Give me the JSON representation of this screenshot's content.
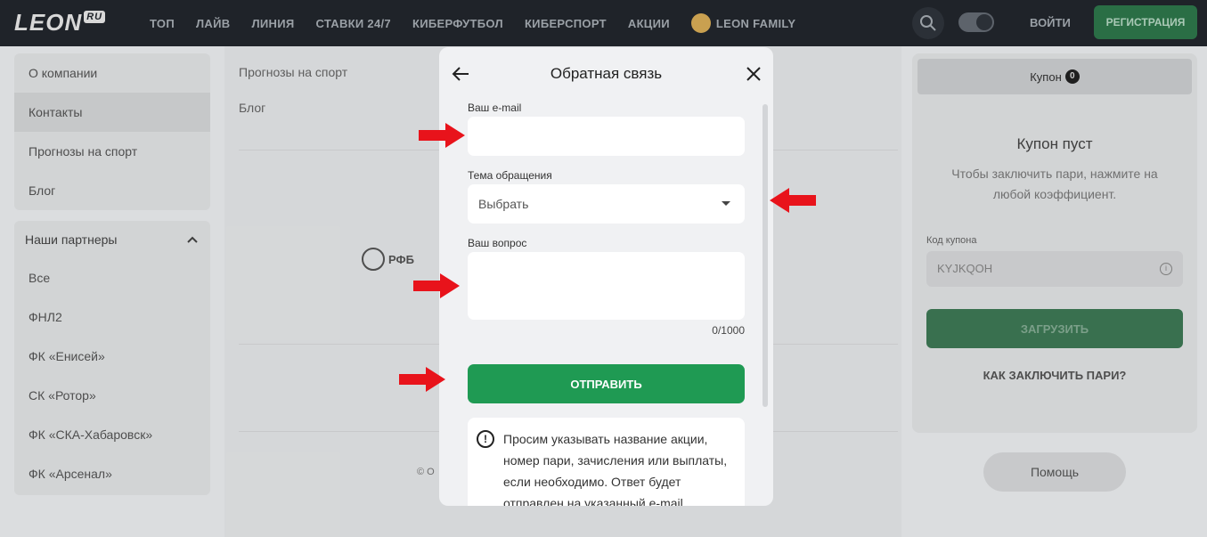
{
  "header": {
    "logo_text": "LEON",
    "logo_suffix": "RU",
    "nav": [
      "ТОП",
      "ЛАЙВ",
      "ЛИНИЯ",
      "СТАВКИ 24/7",
      "КИБЕРФУТБОЛ",
      "КИБЕРСПОРТ",
      "АКЦИИ"
    ],
    "family_label": "LEON FAMILY",
    "login_label": "ВОЙТИ",
    "register_label": "РЕГИСТРАЦИЯ"
  },
  "sidebar": {
    "info_items": [
      "О компании",
      "Контакты",
      "Прогнозы на спорт",
      "Блог"
    ],
    "partners_title": "Наши партнеры",
    "partner_items": [
      "Все",
      "ФНЛ2",
      "ФК «Енисей»",
      "СК «Ротор»",
      "ФК «СКА-Хабаровск»",
      "ФК «Арсенал»"
    ]
  },
  "center": {
    "link1": "Прогнозы на спорт",
    "link2": "Блог",
    "partner_logo": "РФБ",
    "copyright": "© О"
  },
  "coupon": {
    "tab_label": "Купон",
    "tab_count": "0",
    "empty_title": "Купон пуст",
    "empty_hint": "Чтобы заключить пари, нажмите на любой коэффициент.",
    "code_label": "Код купона",
    "code_value": "KYJKQOH",
    "load_label": "ЗАГРУЗИТЬ",
    "how_label": "КАК ЗАКЛЮЧИТЬ ПАРИ?",
    "help_label": "Помощь"
  },
  "modal": {
    "title": "Обратная связь",
    "email_label": "Ваш e-mail",
    "email_value": "",
    "topic_label": "Тема обращения",
    "topic_value": "Выбрать",
    "question_label": "Ваш вопрос",
    "question_value": "",
    "counter": "0/1000",
    "submit_label": "ОТПРАВИТЬ",
    "notice_text": "Просим указывать название акции, номер пари, зачисления или выплаты, если необходимо. Ответ будет отправлен на указанный e-mail"
  },
  "colors": {
    "accent_green": "#1f9a53",
    "topbar": "#1f2329",
    "arrow_red": "#e8131b"
  }
}
